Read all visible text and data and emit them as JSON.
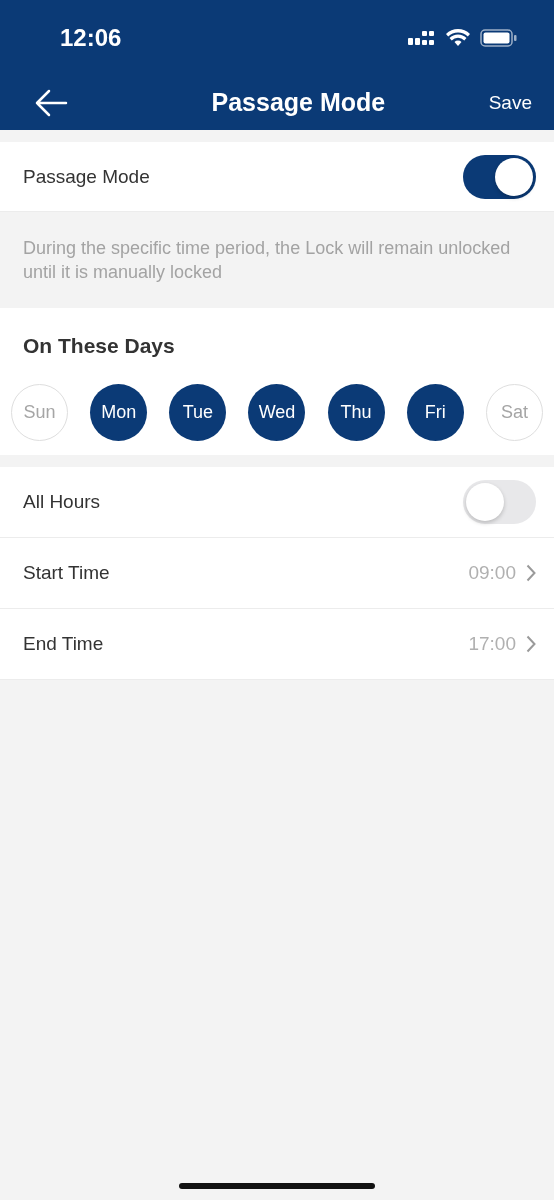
{
  "status_bar": {
    "time": "12:06"
  },
  "nav": {
    "title": "Passage Mode",
    "action": "Save"
  },
  "passage_mode": {
    "label": "Passage Mode",
    "on": true
  },
  "description": "During the specific time period, the Lock will remain unlocked until it is manually locked",
  "days_section": {
    "title": "On These Days",
    "days": [
      {
        "label": "Sun",
        "selected": false
      },
      {
        "label": "Mon",
        "selected": true
      },
      {
        "label": "Tue",
        "selected": true
      },
      {
        "label": "Wed",
        "selected": true
      },
      {
        "label": "Thu",
        "selected": true
      },
      {
        "label": "Fri",
        "selected": true
      },
      {
        "label": "Sat",
        "selected": false
      }
    ]
  },
  "settings": [
    {
      "kind": "toggle",
      "label": "All Hours",
      "on": false
    },
    {
      "kind": "time",
      "label": "Start Time",
      "value": "09:00"
    },
    {
      "kind": "time",
      "label": "End Time",
      "value": "17:00"
    }
  ]
}
